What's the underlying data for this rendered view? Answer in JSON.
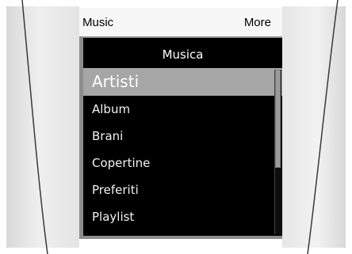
{
  "topbar": {
    "left_label": "Music",
    "right_label": "More"
  },
  "screen": {
    "title": "Musica",
    "items": [
      {
        "label": "Artisti",
        "selected": true
      },
      {
        "label": "Album",
        "selected": false
      },
      {
        "label": "Brani",
        "selected": false
      },
      {
        "label": "Copertine",
        "selected": false
      },
      {
        "label": "Preferiti",
        "selected": false
      },
      {
        "label": "Playlist",
        "selected": false
      }
    ]
  },
  "colors": {
    "screen_bg": "#000000",
    "selected_bg": "#a6a6a6",
    "frame_gray": "#8d8d8d"
  }
}
